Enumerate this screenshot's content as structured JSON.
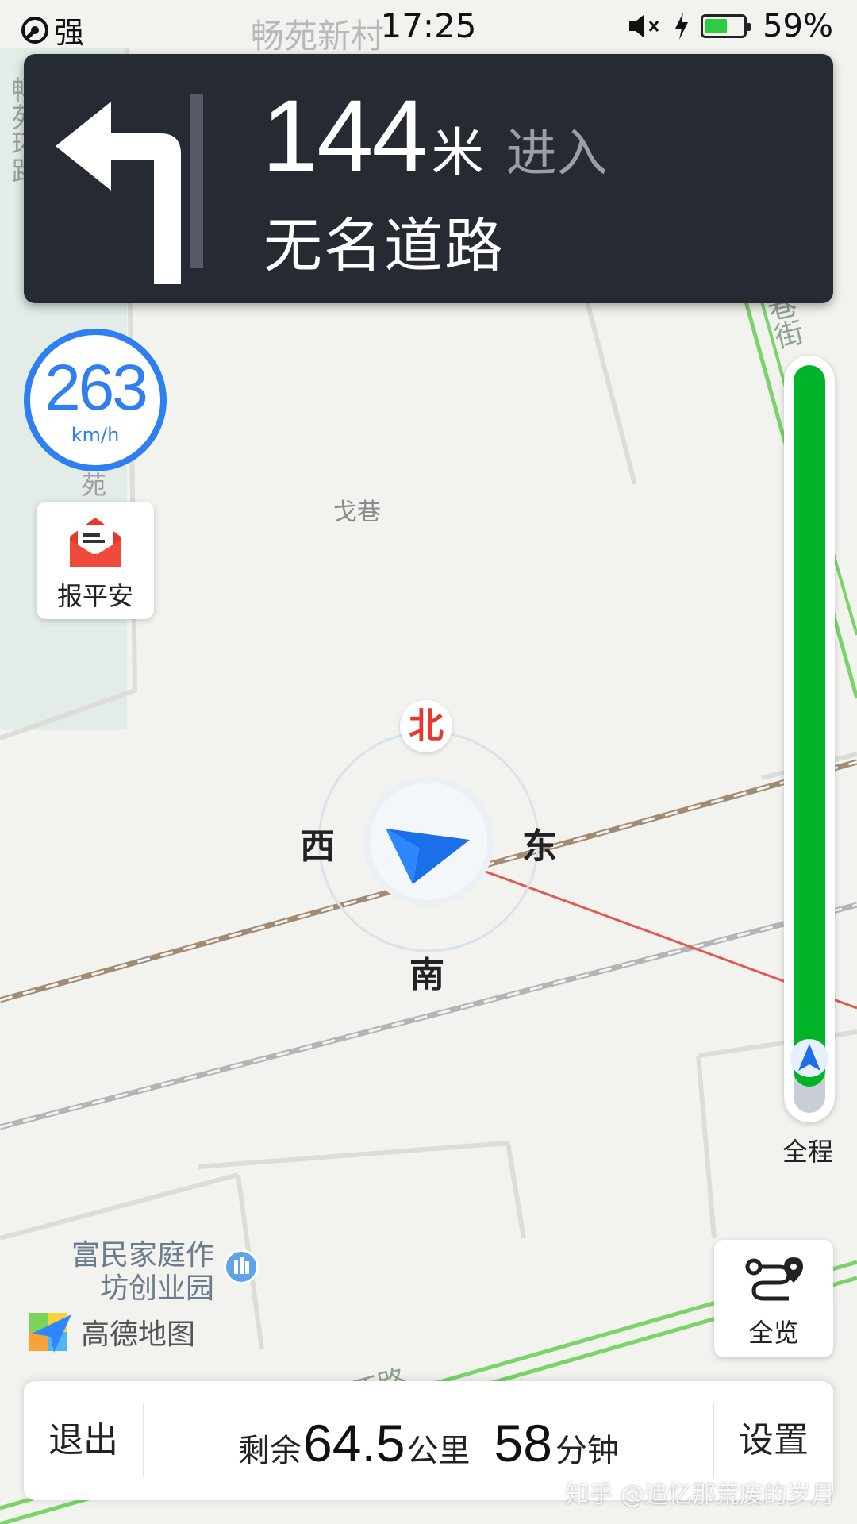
{
  "status_bar": {
    "signal_label": "强",
    "time": "17:25",
    "battery_percent": "59%",
    "battery_level": 0.59,
    "icons": [
      "wifi-call-icon",
      "mute-icon",
      "charging-icon",
      "battery-icon"
    ]
  },
  "guidance": {
    "distance": "144",
    "distance_unit": "米",
    "action": "进入",
    "road_name": "无名道路",
    "maneuver_icon": "turn-left-icon"
  },
  "speed": {
    "value": "263",
    "unit": "km/h"
  },
  "safety": {
    "label": "报平安",
    "icon": "envelope-icon"
  },
  "map_labels": {
    "top_area": "畅苑新村",
    "top_left": "畅苑环路",
    "street_right": "巷街",
    "lane": "戈巷",
    "side_fragment": "苑",
    "poi_name_line1": "富民家庭作",
    "poi_name_line2": "坊创业园",
    "bottom_road": "金陵西路"
  },
  "compass": {
    "north": "北",
    "south": "南",
    "east": "东",
    "west": "西"
  },
  "route_progress": {
    "completed_fraction": 0.965,
    "label": "全程"
  },
  "overview": {
    "label": "全览",
    "icon": "route-overview-icon"
  },
  "logo": {
    "text": "高德地图"
  },
  "bottom_bar": {
    "exit_label": "退出",
    "remaining_label": "剩余",
    "remaining_distance": "64.5",
    "distance_unit": "公里",
    "remaining_time": "58",
    "time_unit": "分钟",
    "settings_label": "设置"
  },
  "watermark": "知乎 @追忆那荒废的岁月",
  "colors": {
    "panel_bg": "#262a33",
    "accent_blue": "#2f7ff0",
    "route_green": "#00b42a",
    "north_red": "#e8382b"
  }
}
